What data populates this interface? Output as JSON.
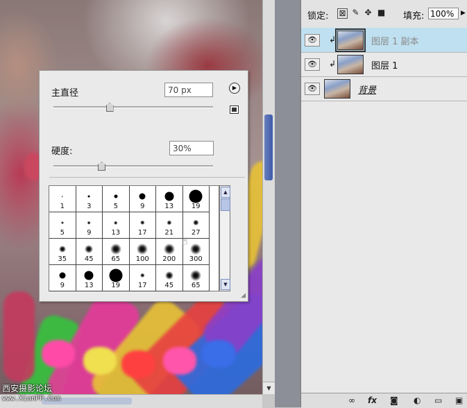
{
  "layers_panel": {
    "lock_label": "锁定:",
    "fill_label": "填充:",
    "fill_value": "100%",
    "layers": [
      {
        "name": "图层 1 副本",
        "selected": true,
        "visible": true,
        "clipped": true
      },
      {
        "name": "图层 1",
        "selected": false,
        "visible": true,
        "clipped": true
      },
      {
        "name": "背景",
        "selected": false,
        "visible": true,
        "clipped": false
      }
    ],
    "bottom_icons": [
      "link-icon",
      "fx-icon",
      "mask-icon",
      "adjustment-icon",
      "group-icon",
      "new-layer-icon"
    ],
    "fx_label": "fx"
  },
  "brush_picker": {
    "diameter_label": "主直径",
    "diameter_value": "70 px",
    "diameter_level": 0.35,
    "hardness_label": "硬度:",
    "hardness_value": "30%",
    "hardness_level": 0.3,
    "presets": [
      {
        "size": "1",
        "kind": "hard"
      },
      {
        "size": "3",
        "kind": "hard"
      },
      {
        "size": "5",
        "kind": "hard"
      },
      {
        "size": "9",
        "kind": "hard"
      },
      {
        "size": "13",
        "kind": "hard"
      },
      {
        "size": "19",
        "kind": "hard"
      },
      {
        "size": "5",
        "kind": "soft"
      },
      {
        "size": "9",
        "kind": "soft"
      },
      {
        "size": "13",
        "kind": "soft"
      },
      {
        "size": "17",
        "kind": "soft"
      },
      {
        "size": "21",
        "kind": "soft"
      },
      {
        "size": "27",
        "kind": "soft"
      },
      {
        "size": "35",
        "kind": "soft"
      },
      {
        "size": "45",
        "kind": "soft"
      },
      {
        "size": "65",
        "kind": "soft"
      },
      {
        "size": "100",
        "kind": "soft"
      },
      {
        "size": "200",
        "kind": "soft"
      },
      {
        "size": "300",
        "kind": "soft"
      },
      {
        "size": "9",
        "kind": "hard"
      },
      {
        "size": "13",
        "kind": "hard"
      },
      {
        "size": "19",
        "kind": "hard"
      },
      {
        "size": "17",
        "kind": "soft"
      },
      {
        "size": "45",
        "kind": "soft"
      },
      {
        "size": "65",
        "kind": "soft"
      }
    ]
  },
  "watermark": {
    "line1": "西安摄影论坛",
    "line2": "www.XianPP.Com"
  },
  "colors": {
    "selected_layer": "#bfe0f0",
    "panel": "#eaeaea",
    "scroll_thumb": "#3d5aa8"
  }
}
